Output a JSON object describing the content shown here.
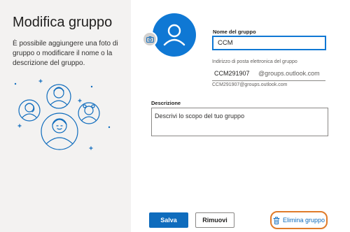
{
  "left_pane": {
    "title": "Modifica gruppo",
    "description": "È possibile aggiungere una foto di gruppo o modificare il nome o la descrizione del gruppo.",
    "illustration": "people-group-illustration"
  },
  "avatar": {
    "icon": "person-icon",
    "camera_icon": "camera-icon",
    "color": "#0f78d4"
  },
  "group_name": {
    "label": "Nome del gruppo",
    "value": "CCM"
  },
  "email": {
    "label": "Indirizzo di posta elettronica del gruppo",
    "alias": "CCM291907",
    "domain": "@groups.outlook.com",
    "full_address": "CCM291907@groups.outlook.com"
  },
  "description": {
    "label": "Descrizione",
    "placeholder": "Descrivi lo scopo del tuo gruppo",
    "value": ""
  },
  "footer": {
    "save_label": "Salva",
    "remove_label": "Rimuovi",
    "delete_label": "Elimina gruppo",
    "delete_icon": "trash-icon"
  },
  "colors": {
    "accent": "#0f6cbd",
    "highlight": "#e07b2a"
  }
}
